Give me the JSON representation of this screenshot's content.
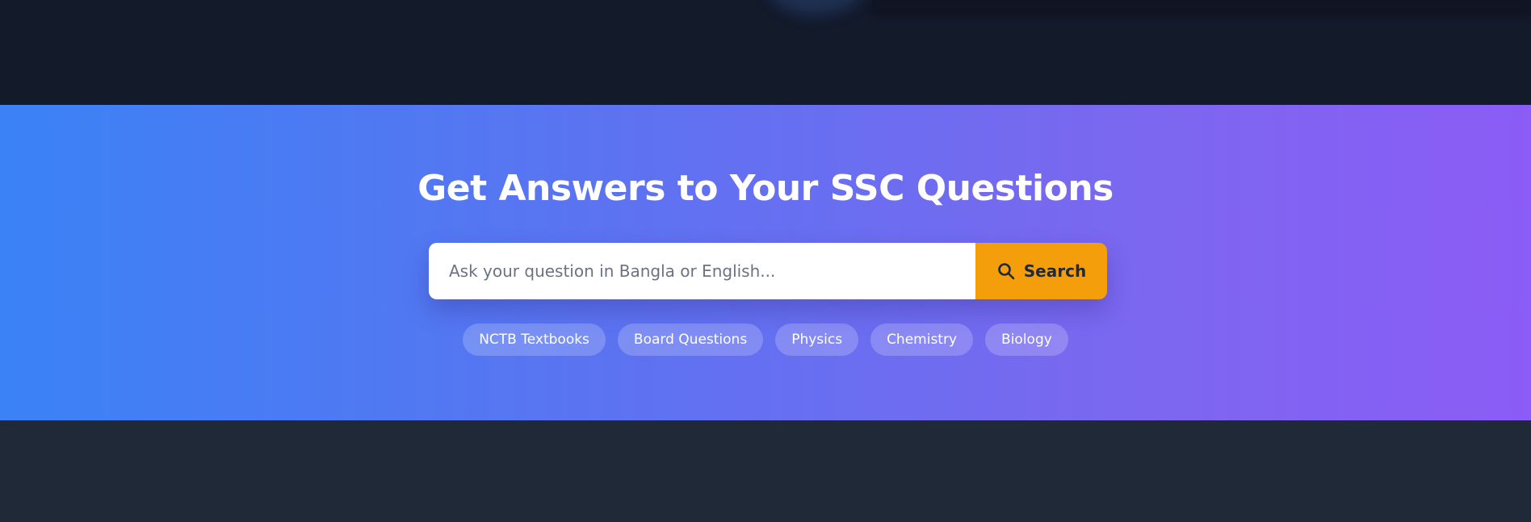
{
  "hero": {
    "title": "Get Answers to Your SSC Questions",
    "gradient_start": "#3b82f6",
    "gradient_end": "#8b5cf6"
  },
  "search": {
    "placeholder": "Ask your question in Bangla or English...",
    "value": "",
    "button_label": "Search",
    "button_icon": "search-icon",
    "button_color": "#f59e0b"
  },
  "tags": [
    {
      "label": "NCTB Textbooks"
    },
    {
      "label": "Board Questions"
    },
    {
      "label": "Physics"
    },
    {
      "label": "Chemistry"
    },
    {
      "label": "Biology"
    }
  ],
  "colors": {
    "top_background": "#131a2a",
    "bottom_background": "#1f2937"
  }
}
